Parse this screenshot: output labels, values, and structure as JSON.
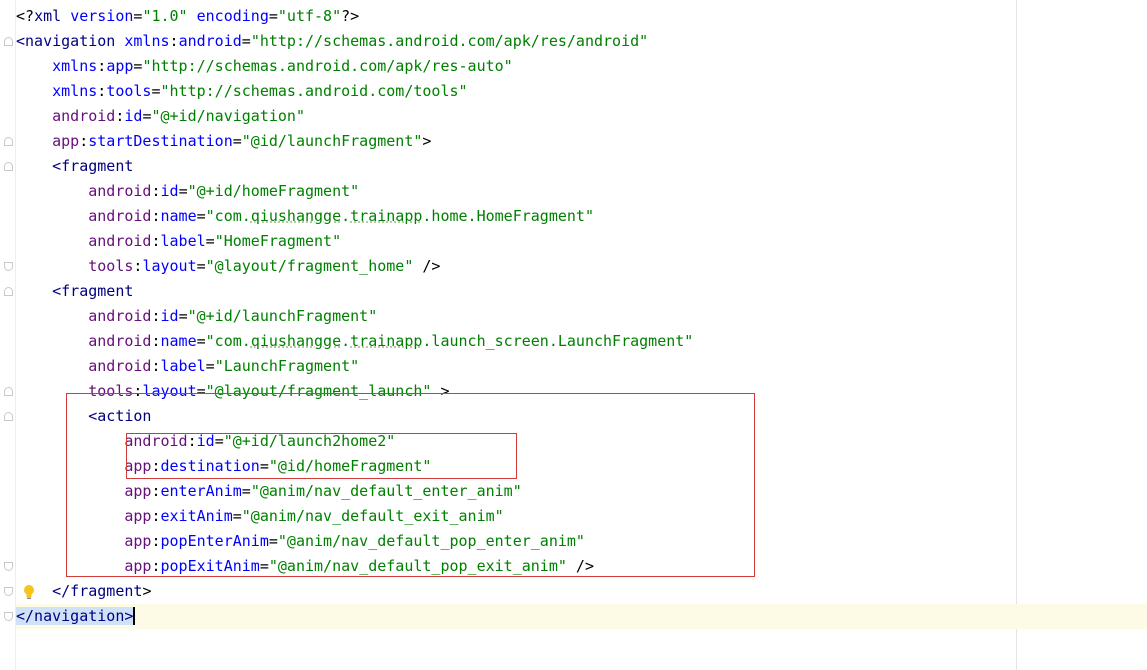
{
  "editor": {
    "lines": [
      {
        "t": "prolog",
        "text": "<?xml version=\"1.0\" encoding=\"utf-8\"?>"
      },
      {
        "t": "code",
        "parts": [
          [
            "tag",
            "<navigation"
          ],
          [
            "punct",
            " "
          ],
          [
            "attr",
            "xmlns"
          ],
          [
            "punct",
            ":"
          ],
          [
            "attr",
            "android"
          ],
          [
            "punct",
            "="
          ],
          [
            "val",
            "\"http://schemas.android.com/apk/res/android\""
          ]
        ]
      },
      {
        "t": "code",
        "parts": [
          [
            "punct",
            "    "
          ],
          [
            "attr",
            "xmlns"
          ],
          [
            "punct",
            ":"
          ],
          [
            "attr",
            "app"
          ],
          [
            "punct",
            "="
          ],
          [
            "val",
            "\"http://schemas.android.com/apk/res-auto\""
          ]
        ]
      },
      {
        "t": "code",
        "parts": [
          [
            "punct",
            "    "
          ],
          [
            "attr",
            "xmlns"
          ],
          [
            "punct",
            ":"
          ],
          [
            "attr",
            "tools"
          ],
          [
            "punct",
            "="
          ],
          [
            "val",
            "\"http://schemas.android.com/tools\""
          ]
        ]
      },
      {
        "t": "code",
        "parts": [
          [
            "punct",
            "    "
          ],
          [
            "ns",
            "android"
          ],
          [
            "punct",
            ":"
          ],
          [
            "attr",
            "id"
          ],
          [
            "punct",
            "="
          ],
          [
            "val",
            "\"@+id/navigation\""
          ]
        ]
      },
      {
        "t": "code",
        "parts": [
          [
            "punct",
            "    "
          ],
          [
            "ns",
            "app"
          ],
          [
            "punct",
            ":"
          ],
          [
            "attr",
            "startDestination"
          ],
          [
            "punct",
            "="
          ],
          [
            "val",
            "\"@id/launchFragment\""
          ],
          [
            "punct",
            ">"
          ]
        ]
      },
      {
        "t": "code",
        "parts": [
          [
            "punct",
            "    "
          ],
          [
            "tag",
            "<fragment"
          ]
        ]
      },
      {
        "t": "code",
        "parts": [
          [
            "punct",
            "        "
          ],
          [
            "ns",
            "android"
          ],
          [
            "punct",
            ":"
          ],
          [
            "attr",
            "id"
          ],
          [
            "punct",
            "="
          ],
          [
            "val",
            "\"@+id/homeFragment\""
          ]
        ]
      },
      {
        "t": "code",
        "parts": [
          [
            "punct",
            "        "
          ],
          [
            "ns",
            "android"
          ],
          [
            "punct",
            ":"
          ],
          [
            "attr",
            "name"
          ],
          [
            "punct",
            "="
          ],
          [
            "val",
            "\"com."
          ],
          [
            "valtypo",
            "qiushangge"
          ],
          [
            "val",
            "."
          ],
          [
            "valtypo",
            "trainapp"
          ],
          [
            "val",
            ".home.HomeFragment\""
          ]
        ]
      },
      {
        "t": "code",
        "parts": [
          [
            "punct",
            "        "
          ],
          [
            "ns",
            "android"
          ],
          [
            "punct",
            ":"
          ],
          [
            "attr",
            "label"
          ],
          [
            "punct",
            "="
          ],
          [
            "val",
            "\"HomeFragment\""
          ]
        ]
      },
      {
        "t": "code",
        "parts": [
          [
            "punct",
            "        "
          ],
          [
            "ns",
            "tools"
          ],
          [
            "punct",
            ":"
          ],
          [
            "attr",
            "layout"
          ],
          [
            "punct",
            "="
          ],
          [
            "val",
            "\"@layout/fragment_home\""
          ],
          [
            "punct",
            " />"
          ]
        ]
      },
      {
        "t": "code",
        "parts": [
          [
            "punct",
            "    "
          ],
          [
            "tag",
            "<fragment"
          ]
        ]
      },
      {
        "t": "code",
        "parts": [
          [
            "punct",
            "        "
          ],
          [
            "ns",
            "android"
          ],
          [
            "punct",
            ":"
          ],
          [
            "attr",
            "id"
          ],
          [
            "punct",
            "="
          ],
          [
            "val",
            "\"@+id/launchFragment\""
          ]
        ]
      },
      {
        "t": "code",
        "parts": [
          [
            "punct",
            "        "
          ],
          [
            "ns",
            "android"
          ],
          [
            "punct",
            ":"
          ],
          [
            "attr",
            "name"
          ],
          [
            "punct",
            "="
          ],
          [
            "val",
            "\"com."
          ],
          [
            "valtypo",
            "qiushangge"
          ],
          [
            "val",
            "."
          ],
          [
            "valtypo",
            "trainapp"
          ],
          [
            "val",
            ".launch_screen.LaunchFragment\""
          ]
        ]
      },
      {
        "t": "code",
        "parts": [
          [
            "punct",
            "        "
          ],
          [
            "ns",
            "android"
          ],
          [
            "punct",
            ":"
          ],
          [
            "attr",
            "label"
          ],
          [
            "punct",
            "="
          ],
          [
            "val",
            "\"LaunchFragment\""
          ]
        ]
      },
      {
        "t": "code",
        "parts": [
          [
            "punct",
            "        "
          ],
          [
            "ns",
            "tools"
          ],
          [
            "punct",
            ":"
          ],
          [
            "attr",
            "layout"
          ],
          [
            "punct",
            "="
          ],
          [
            "val",
            "\"@layout/fragment_launch\""
          ],
          [
            "punct",
            " >"
          ]
        ]
      },
      {
        "t": "code",
        "parts": [
          [
            "punct",
            "        "
          ],
          [
            "tag",
            "<action"
          ]
        ]
      },
      {
        "t": "code",
        "parts": [
          [
            "punct",
            "            "
          ],
          [
            "ns",
            "android"
          ],
          [
            "punct",
            ":"
          ],
          [
            "attr",
            "id"
          ],
          [
            "punct",
            "="
          ],
          [
            "val",
            "\"@+id/launch2home2\""
          ]
        ]
      },
      {
        "t": "code",
        "parts": [
          [
            "punct",
            "            "
          ],
          [
            "ns",
            "app"
          ],
          [
            "punct",
            ":"
          ],
          [
            "attr",
            "destination"
          ],
          [
            "punct",
            "="
          ],
          [
            "val",
            "\"@id/homeFragment\""
          ]
        ]
      },
      {
        "t": "code",
        "parts": [
          [
            "punct",
            "            "
          ],
          [
            "ns",
            "app"
          ],
          [
            "punct",
            ":"
          ],
          [
            "attr",
            "enterAnim"
          ],
          [
            "punct",
            "="
          ],
          [
            "val",
            "\"@anim/nav_default_enter_anim\""
          ]
        ]
      },
      {
        "t": "code",
        "parts": [
          [
            "punct",
            "            "
          ],
          [
            "ns",
            "app"
          ],
          [
            "punct",
            ":"
          ],
          [
            "attr",
            "exitAnim"
          ],
          [
            "punct",
            "="
          ],
          [
            "val",
            "\"@anim/nav_default_exit_anim\""
          ]
        ]
      },
      {
        "t": "code",
        "parts": [
          [
            "punct",
            "            "
          ],
          [
            "ns",
            "app"
          ],
          [
            "punct",
            ":"
          ],
          [
            "attr",
            "popEnterAnim"
          ],
          [
            "punct",
            "="
          ],
          [
            "val",
            "\"@anim/nav_default_pop_enter_anim\""
          ]
        ]
      },
      {
        "t": "code",
        "parts": [
          [
            "punct",
            "            "
          ],
          [
            "ns",
            "app"
          ],
          [
            "punct",
            ":"
          ],
          [
            "attr",
            "popExitAnim"
          ],
          [
            "punct",
            "="
          ],
          [
            "val",
            "\"@anim/nav_default_pop_exit_anim\""
          ],
          [
            "punct",
            " />"
          ]
        ]
      },
      {
        "t": "code",
        "parts": [
          [
            "punct",
            "    "
          ],
          [
            "tag",
            "</fragment"
          ],
          [
            "punct",
            ">"
          ]
        ]
      },
      {
        "t": "code",
        "parts": [
          [
            "sel",
            "</navigation>"
          ]
        ]
      }
    ],
    "current_line_index": 24,
    "bulb_icon": "lightbulb-icon",
    "colors": {
      "tag": "#000080",
      "attribute": "#0000ff",
      "namespace": "#660e7a",
      "value": "#008000",
      "annotation_box": "#d33a3a",
      "current_line": "#fdfbe6",
      "selection": "#cfe2f7"
    }
  }
}
